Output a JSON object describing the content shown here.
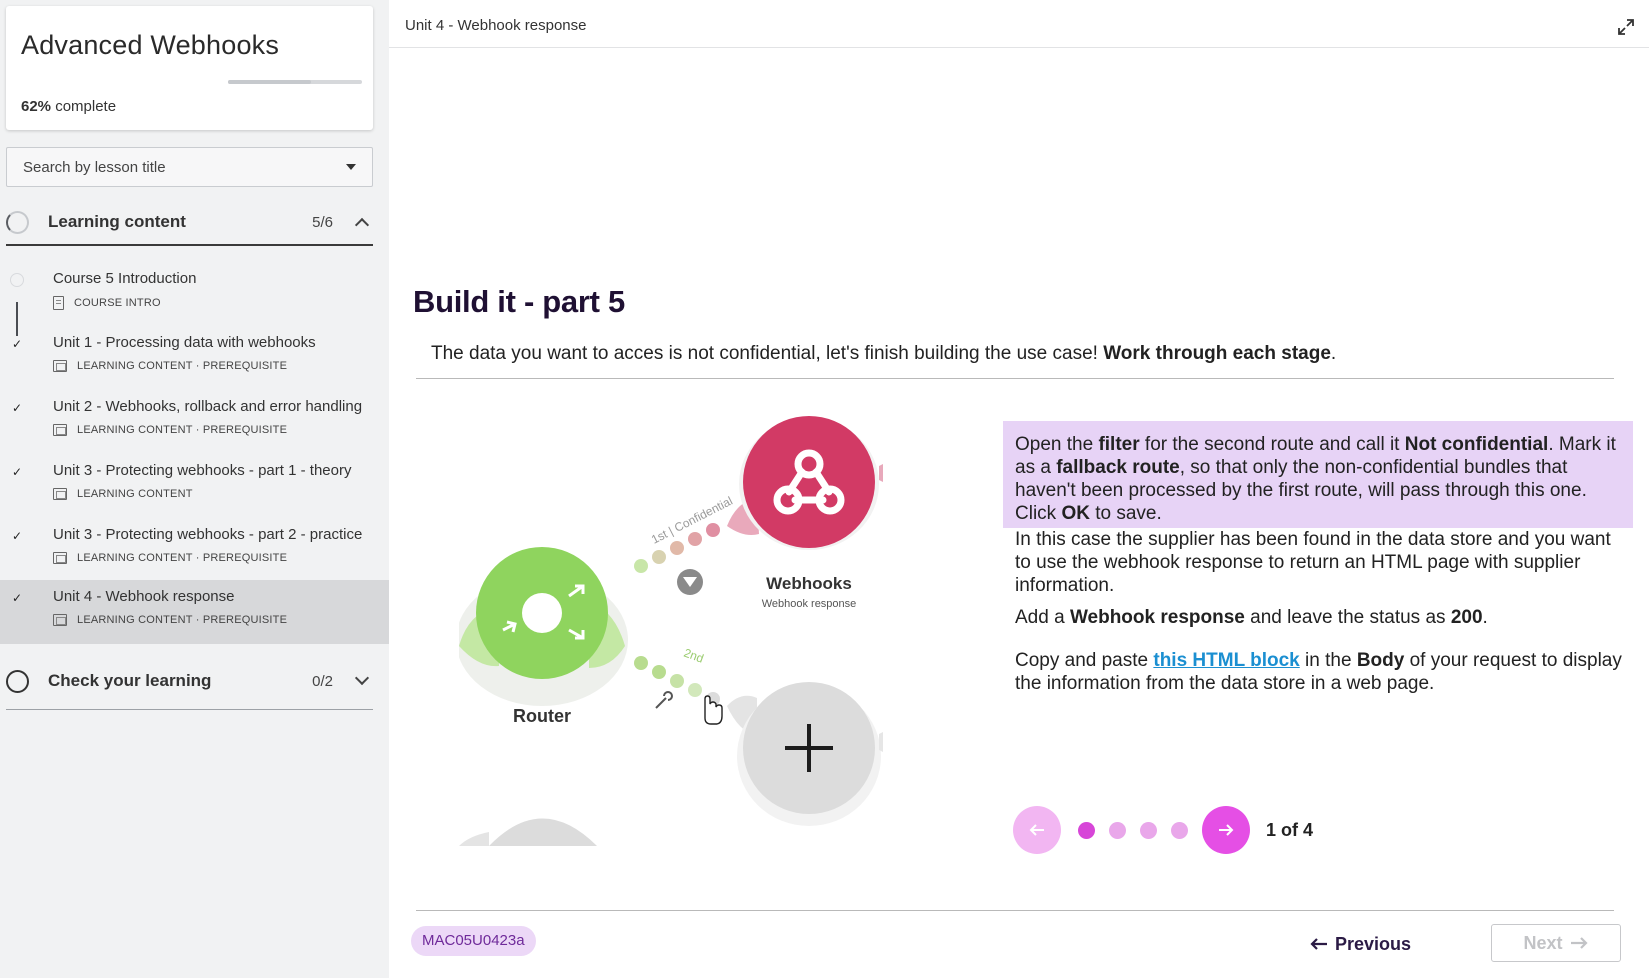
{
  "course": {
    "title": "Advanced Webhooks",
    "progress_percent": "62%",
    "progress_suffix": " complete",
    "progress_fraction": 0.62
  },
  "search": {
    "placeholder": "Search by lesson title"
  },
  "sections": [
    {
      "title": "Learning content",
      "count": "5/6",
      "expanded": true
    },
    {
      "title": "Check your learning",
      "count": "0/2",
      "expanded": false
    }
  ],
  "lessons": [
    {
      "title": "Course 5 Introduction",
      "meta": "COURSE INTRO",
      "completed": false
    },
    {
      "title": "Unit 1 - Processing data with webhooks",
      "meta": "LEARNING CONTENT · PREREQUISITE",
      "completed": true
    },
    {
      "title": "Unit 2 - Webhooks, rollback and error handling",
      "meta": "LEARNING CONTENT · PREREQUISITE",
      "completed": true
    },
    {
      "title": "Unit 3 - Protecting webhooks - part 1 - theory",
      "meta": "LEARNING CONTENT",
      "completed": true
    },
    {
      "title": "Unit 3 - Protecting webhooks - part 2 - practice",
      "meta": "LEARNING CONTENT · PREREQUISITE",
      "completed": true
    },
    {
      "title": "Unit 4 - Webhook response",
      "meta": "LEARNING CONTENT · PREREQUISITE",
      "completed": true,
      "active": true
    }
  ],
  "topbar": {
    "breadcrumb": "Unit 4 - Webhook response"
  },
  "content": {
    "heading": "Build it - part 5",
    "intro_plain": "The data you want to acces is not confidential, let's finish building the use case! ",
    "intro_bold": "Work through each stage",
    "intro_end": ".",
    "diagram": {
      "route1_label": "1st | Confidential",
      "route2_label": "2nd",
      "webhooks_label": "Webhooks",
      "webhooks_sublabel": "Webhook response",
      "router_label": "Router"
    },
    "step": {
      "t1": "Open the ",
      "b1": "filter",
      "t2": " for the second route and call it ",
      "b2": "Not confidential",
      "t3": ". Mark it as a ",
      "b3": "fallback route",
      "t4": ", so that only the non-confidential bundles that haven't been processed by the first route, will pass through this one. Click ",
      "b4": "OK",
      "t5": " to save."
    },
    "p1": "In this case the supplier has been found in the data store and you want to use the webhook response to return an HTML page with supplier information.",
    "p2": {
      "t1": "Add a ",
      "b1": "Webhook response",
      "t2": " and leave the status as ",
      "b2": "200",
      "t3": "."
    },
    "p3": {
      "t1": "Copy and paste ",
      "link": "this HTML block",
      "t2": " in the ",
      "b1": "Body",
      "t3": " of your request to display the information from the data store in a web page."
    }
  },
  "pager": {
    "current": 1,
    "total": 4,
    "label": "1 of 4",
    "prev_icon": "arrow-left-icon",
    "next_icon": "arrow-right-icon"
  },
  "footer": {
    "code": "MAC05U0423a",
    "previous_label": "Previous",
    "next_label": "Next"
  },
  "colors": {
    "accent": "#e54fe5",
    "step_highlight": "#e7d3f6",
    "heading": "#1f1033",
    "link": "#1b8fd1",
    "webhook_node": "#d23a65",
    "router_node": "#8fd45e"
  }
}
